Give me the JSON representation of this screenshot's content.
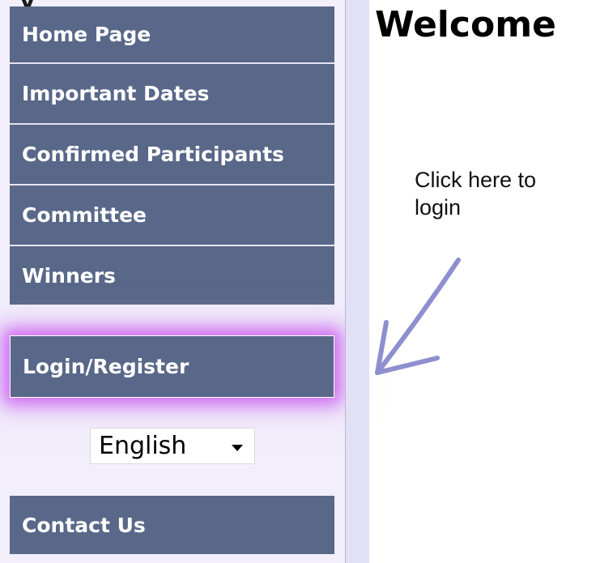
{
  "sidebar": {
    "top_fragment": "y",
    "nav": [
      {
        "label": "Home Page"
      },
      {
        "label": "Important Dates"
      },
      {
        "label": "Confirmed Participants"
      },
      {
        "label": "Committee"
      },
      {
        "label": "Winners"
      }
    ],
    "login_label": "Login/Register",
    "language": {
      "selected": "English"
    },
    "contact_label": "Contact Us"
  },
  "main": {
    "heading": "Welcome",
    "hint_line1": "Click here to",
    "hint_line2": "login"
  },
  "colors": {
    "nav_bg": "#596889",
    "sidebar_bg": "#f2effb",
    "divider_bg": "#e1e0f6",
    "highlight_glow": "#c850f0",
    "arrow": "#8d8fd0"
  },
  "icons": {
    "arrow": "hand-drawn-arrow-icon",
    "dropdown": "caret-down-icon"
  }
}
